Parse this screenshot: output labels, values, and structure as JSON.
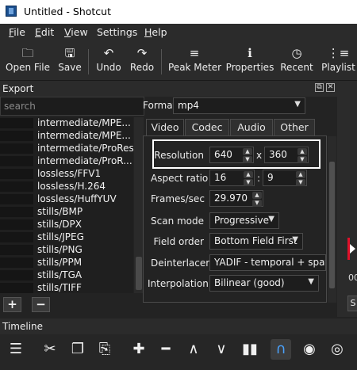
{
  "window": {
    "title": "Untitled - Shotcut"
  },
  "menu": [
    {
      "label": "File",
      "key": "F",
      "rest": "ile"
    },
    {
      "label": "Edit",
      "key": "E",
      "rest": "dit"
    },
    {
      "label": "View",
      "key": "V",
      "rest": "iew"
    },
    {
      "label": "Settings",
      "key": "",
      "rest": "Settings"
    },
    {
      "label": "Help",
      "key": "H",
      "rest": "elp"
    }
  ],
  "toolbar": {
    "open_file": "Open File",
    "save": "Save",
    "undo": "Undo",
    "redo": "Redo",
    "peak_meter": "Peak Meter",
    "properties": "Properties",
    "recent": "Recent",
    "playlist": "Playlist"
  },
  "export": {
    "title": "Export",
    "search_placeholder": "search",
    "format_label": "Format",
    "format_value": "mp4",
    "presets": [
      "intermediate/MPE...",
      "intermediate/MPE...",
      "intermediate/ProRes",
      "intermediate/ProR...",
      "lossless/FFV1",
      "lossless/H.264",
      "lossless/HuffYUV",
      "stills/BMP",
      "stills/DPX",
      "stills/JPEG",
      "stills/PNG",
      "stills/PPM",
      "stills/TGA",
      "stills/TIFF"
    ],
    "tabs": [
      "Video",
      "Codec",
      "Audio",
      "Other"
    ],
    "video": {
      "resolution_label": "Resolution",
      "width": "640",
      "x_sep": "x",
      "height": "360",
      "aspect_label": "Aspect ratio",
      "aspect_num": "16",
      "aspect_sep": ":",
      "aspect_den": "9",
      "fps_label": "Frames/sec",
      "fps": "29.970",
      "scan_label": "Scan mode",
      "scan_value": "Progressive",
      "field_label": "Field order",
      "field_value": "Bottom Field First",
      "deint_label": "Deinterlacer",
      "deint_value": "YADIF - temporal + spatial",
      "interp_label": "Interpolation",
      "interp_value": "Bilinear (good)"
    },
    "add_symbol": "+",
    "remove_symbol": "−"
  },
  "right_strip": {
    "timecode_fragment": "00",
    "button_fragment": "S"
  },
  "timeline": {
    "title": "Timeline"
  },
  "colors": {
    "highlight_box": "#ffffff",
    "accent": "#4aa3ff",
    "playhead": "#e0102a"
  }
}
